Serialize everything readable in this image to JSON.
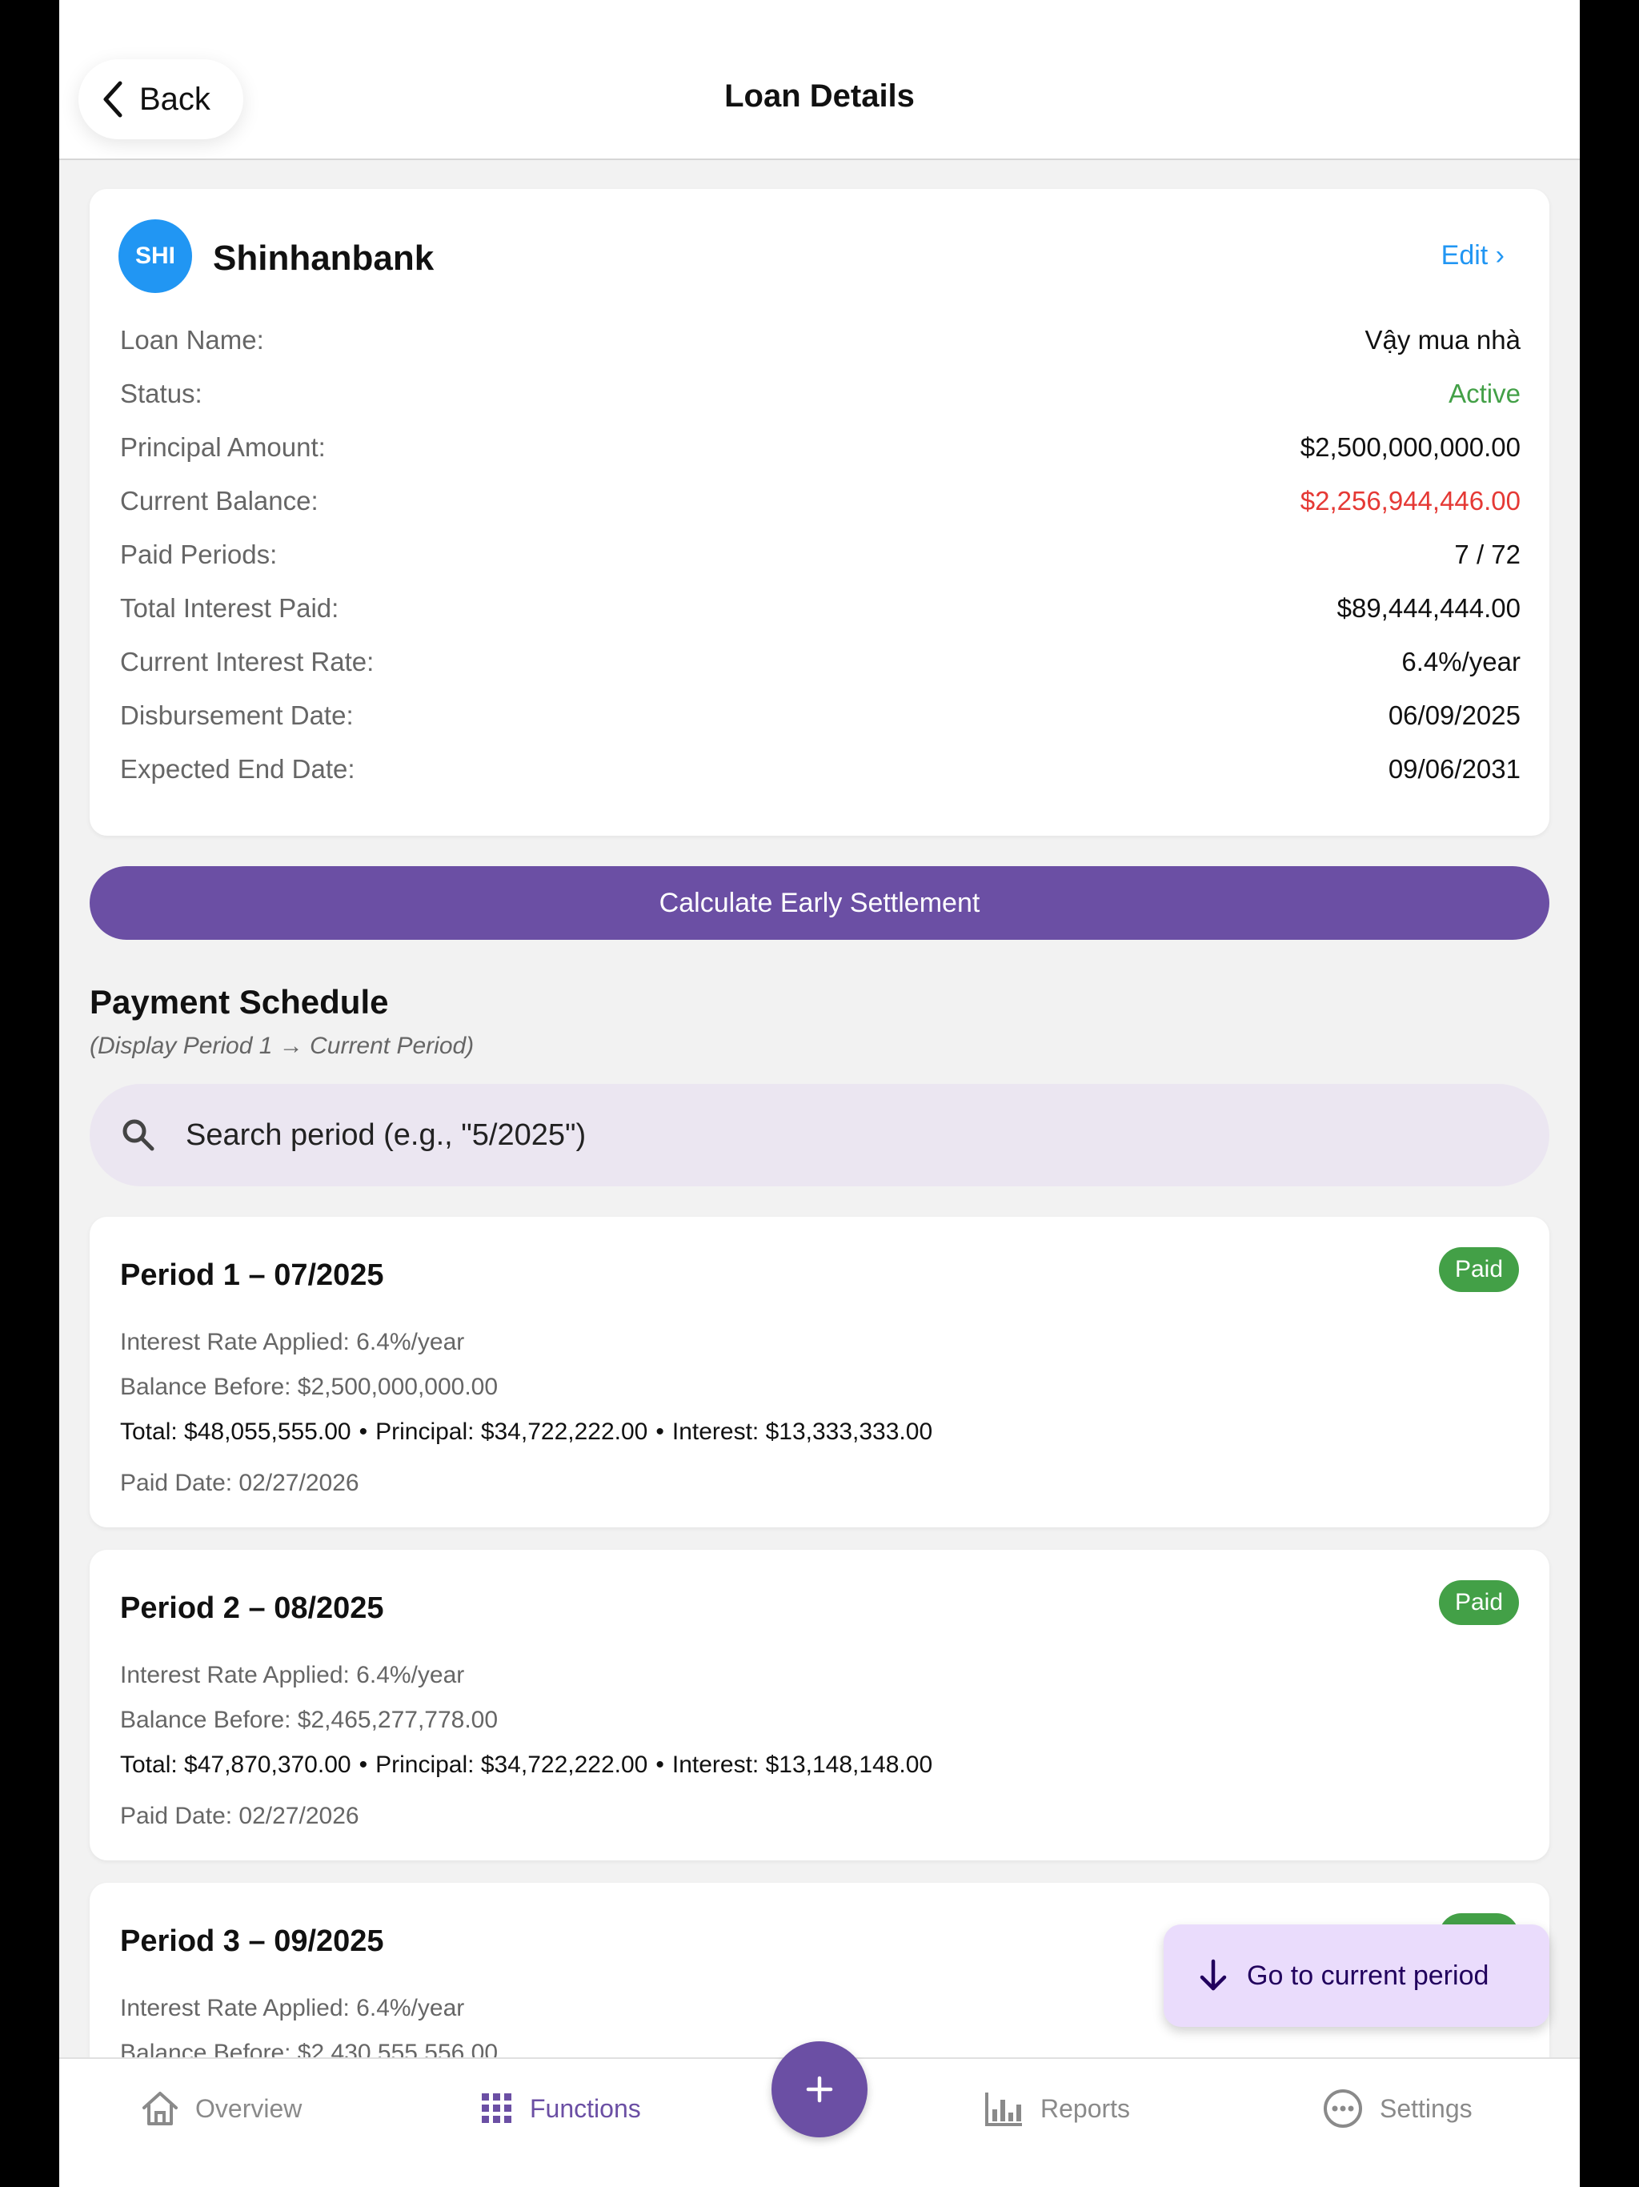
{
  "header": {
    "back_label": "Back",
    "title": "Loan Details"
  },
  "loan": {
    "avatar_text": "SHI",
    "bank_name": "Shinhanbank",
    "edit_label": "Edit ›",
    "rows": [
      {
        "label": "Loan Name:",
        "value": "Vậy mua nhà",
        "color": "#111111"
      },
      {
        "label": "Status:",
        "value": "Active",
        "color": "#43a047"
      },
      {
        "label": "Principal Amount:",
        "value": "$2,500,000,000.00",
        "color": "#111111"
      },
      {
        "label": "Current Balance:",
        "value": "$2,256,944,446.00",
        "color": "#e53935"
      },
      {
        "label": "Paid Periods:",
        "value": "7 / 72",
        "color": "#111111"
      },
      {
        "label": "Total Interest Paid:",
        "value": "$89,444,444.00",
        "color": "#111111"
      },
      {
        "label": "Current Interest Rate:",
        "value": "6.4%/year",
        "color": "#111111"
      },
      {
        "label": "Disbursement Date:",
        "value": "06/09/2025",
        "color": "#111111"
      },
      {
        "label": "Expected End Date:",
        "value": "09/06/2031",
        "color": "#111111"
      }
    ]
  },
  "calc_button_label": "Calculate Early Settlement",
  "schedule": {
    "title": "Payment Schedule",
    "subtitle": "(Display Period 1 → Current Period)",
    "search_placeholder": "Search period (e.g., \"5/2025\")",
    "periods": [
      {
        "title": "Period 1 – 07/2025",
        "status": "Paid",
        "rate": "Interest Rate Applied: 6.4%/year",
        "balance": "Balance Before: $2,500,000,000.00",
        "total": "Total: $48,055,555.00",
        "principal": "Principal: $34,722,222.00",
        "interest": "Interest: $13,333,333.00",
        "paid_date": "Paid Date: 02/27/2026"
      },
      {
        "title": "Period 2 – 08/2025",
        "status": "Paid",
        "rate": "Interest Rate Applied: 6.4%/year",
        "balance": "Balance Before: $2,465,277,778.00",
        "total": "Total: $47,870,370.00",
        "principal": "Principal: $34,722,222.00",
        "interest": "Interest: $13,148,148.00",
        "paid_date": "Paid Date: 02/27/2026"
      },
      {
        "title": "Period 3 – 09/2025",
        "status": "Paid",
        "rate": "Interest Rate Applied: 6.4%/year",
        "balance": "Balance Before: $2,430,555,556.00"
      }
    ],
    "separator": "•"
  },
  "goto_label": "Go to current period",
  "nav": {
    "overview": "Overview",
    "functions": "Functions",
    "reports": "Reports",
    "settings": "Settings"
  },
  "colors": {
    "accent": "#6b4fa4",
    "link": "#2196f3",
    "paid": "#43a047",
    "balance_red": "#e53935"
  },
  "icons": [
    "chevron-left-icon",
    "search-icon",
    "arrow-down-icon",
    "home-icon",
    "grid-icon",
    "plus-icon",
    "bar-chart-icon",
    "more-horizontal-icon"
  ]
}
